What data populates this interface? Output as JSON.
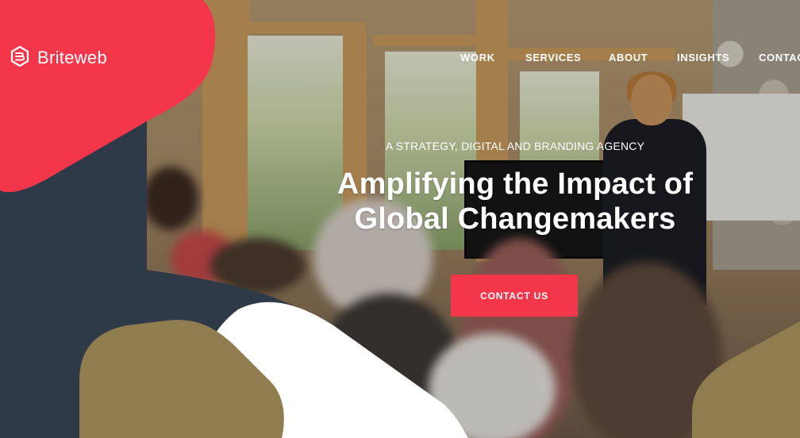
{
  "brand": {
    "name": "Briteweb",
    "logo_icon": "hexagon-b-logo-icon"
  },
  "nav": {
    "items": [
      {
        "label": "WORK"
      },
      {
        "label": "SERVICES"
      },
      {
        "label": "ABOUT"
      },
      {
        "label": "INSIGHTS"
      },
      {
        "label": "CONTAC"
      }
    ]
  },
  "hero": {
    "kicker": "A STRATEGY, DIGITAL AND BRANDING AGENCY",
    "headline_line1": "Amplifying the Impact of",
    "headline_line2": "Global Changemakers",
    "cta_label": "CONTACT US"
  },
  "colors": {
    "red": "#f4364a",
    "navy": "#2f3a48",
    "gold": "#8f7c4f",
    "white": "#ffffff"
  }
}
